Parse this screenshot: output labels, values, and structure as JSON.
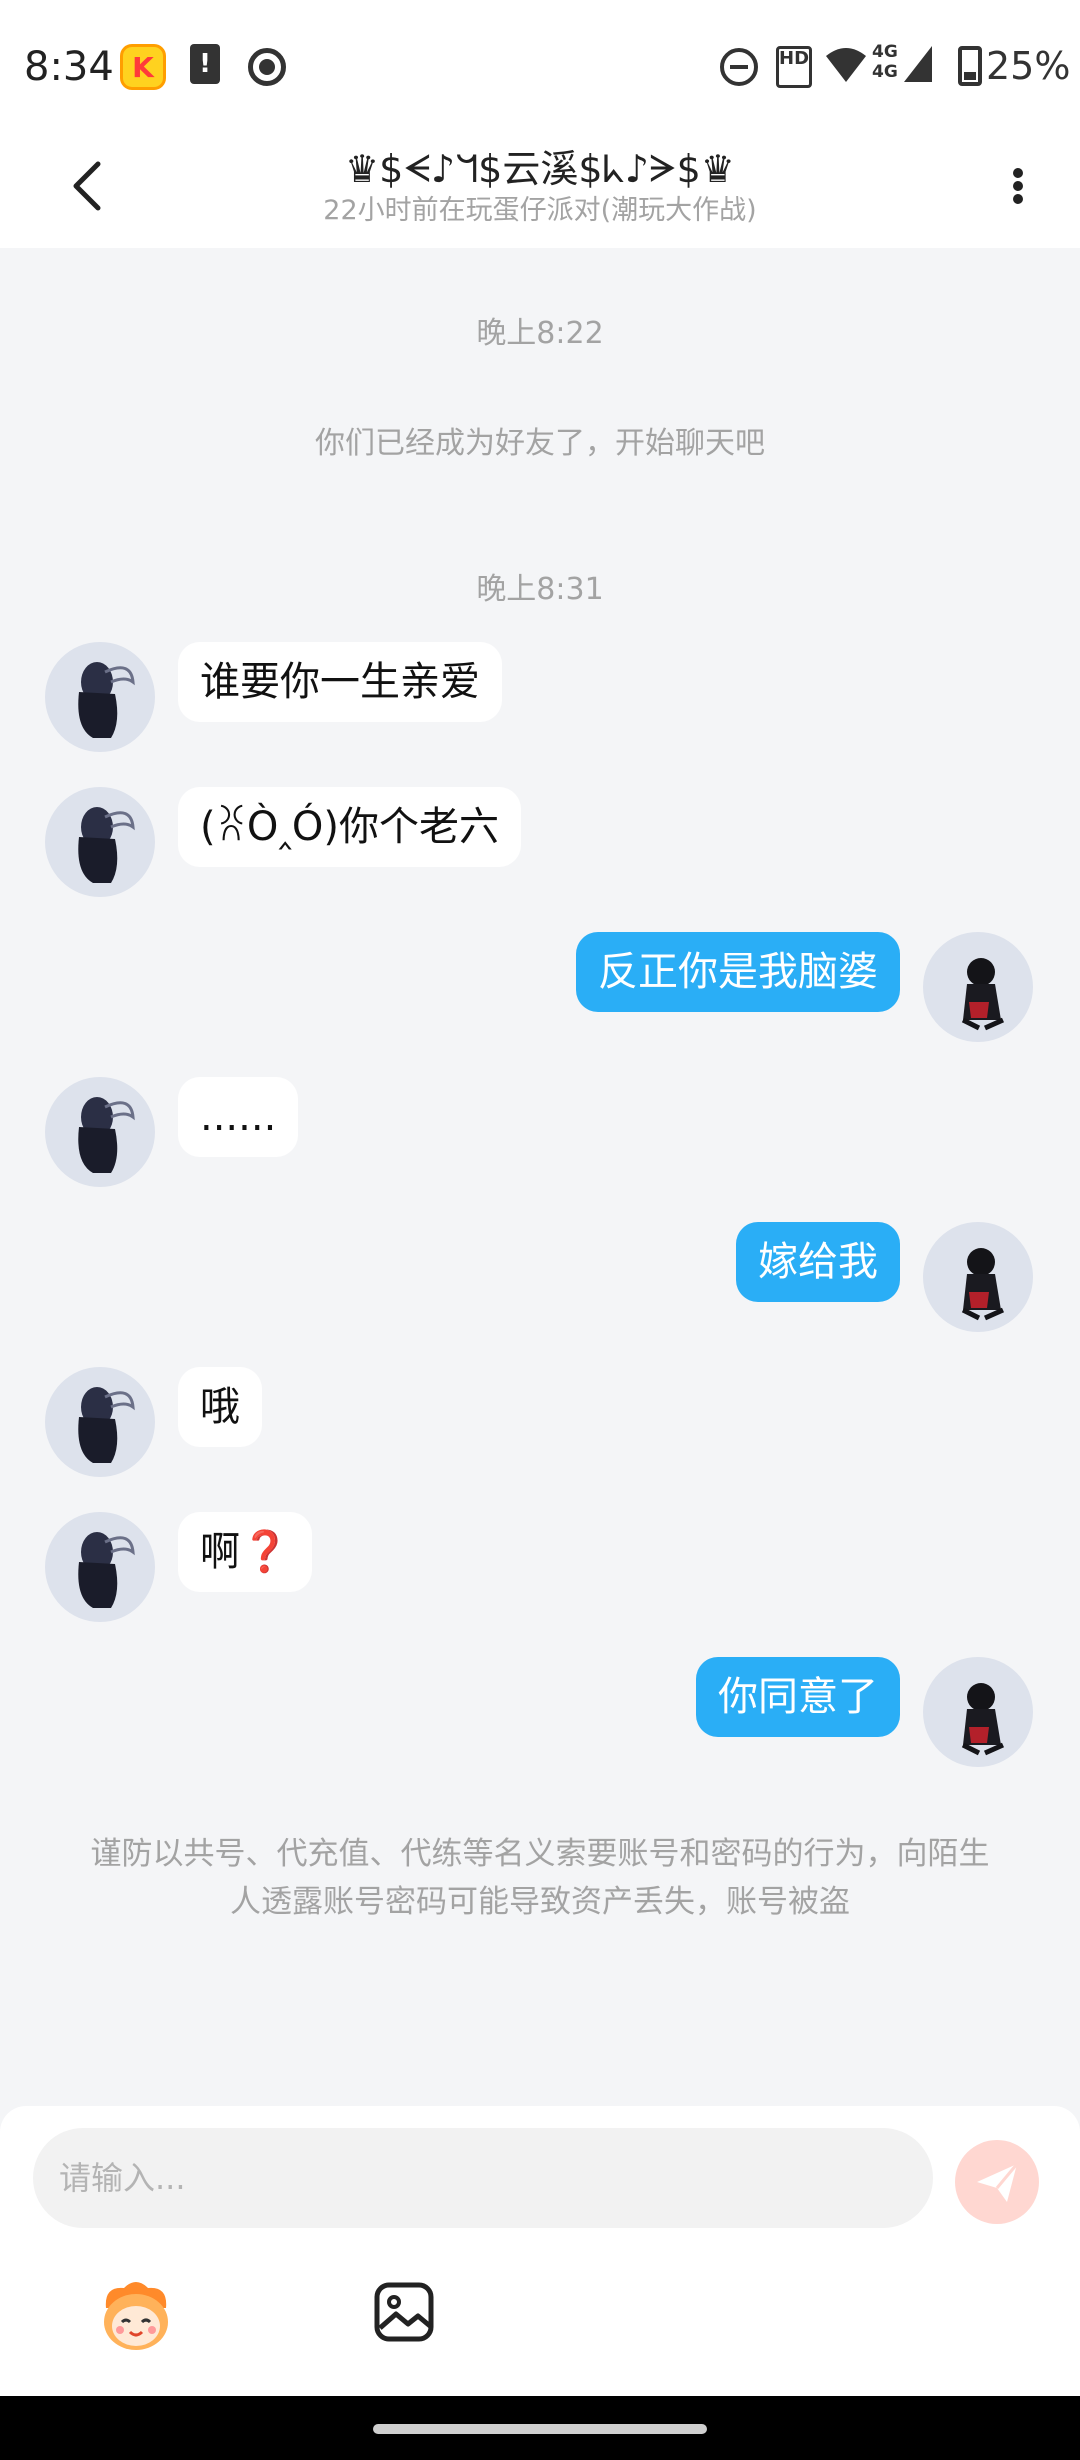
{
  "status_bar": {
    "time": "8:34",
    "battery": "25%",
    "network_top": "4G",
    "network_bottom": "4G"
  },
  "header": {
    "title": "♛$ᗕ♪ᖻ$云溪$ᖾ♪ᗒ$♛",
    "subtitle": "22小时前在玩蛋仔派对(潮玩大作战)"
  },
  "messages": [
    {
      "type": "timestamp",
      "text": "晚上8:22"
    },
    {
      "type": "system",
      "text": "你们已经成为好友了，开始聊天吧"
    },
    {
      "type": "timestamp",
      "text": "晚上8:31"
    },
    {
      "side": "left",
      "text": "谁要你一生亲爱"
    },
    {
      "side": "left",
      "text": "(ꐦÒ‸Ó)你个老六"
    },
    {
      "side": "right",
      "text": "反正你是我脑婆"
    },
    {
      "side": "left",
      "text": "......"
    },
    {
      "side": "right",
      "text": "嫁给我"
    },
    {
      "side": "left",
      "text": "哦"
    },
    {
      "side": "left",
      "text": "啊❓"
    },
    {
      "side": "right",
      "text": "你同意了"
    }
  ],
  "notice": "谨防以共号、代充值、代练等名义索要账号和密码的行为，向陌生人透露账号密码可能导致资产丢失，账号被盗",
  "input": {
    "placeholder": "请输入..."
  },
  "icons": {
    "back": "back-arrow-icon",
    "more": "more-vertical-icon",
    "send": "paper-plane-icon",
    "emoji": "mascot-emoji-icon",
    "image": "image-picker-icon"
  },
  "colors": {
    "outgoing_bubble": "#2aaef6",
    "incoming_bubble": "#ffffff",
    "background": "#f4f5f7",
    "send_button": "#ffd7d1"
  }
}
